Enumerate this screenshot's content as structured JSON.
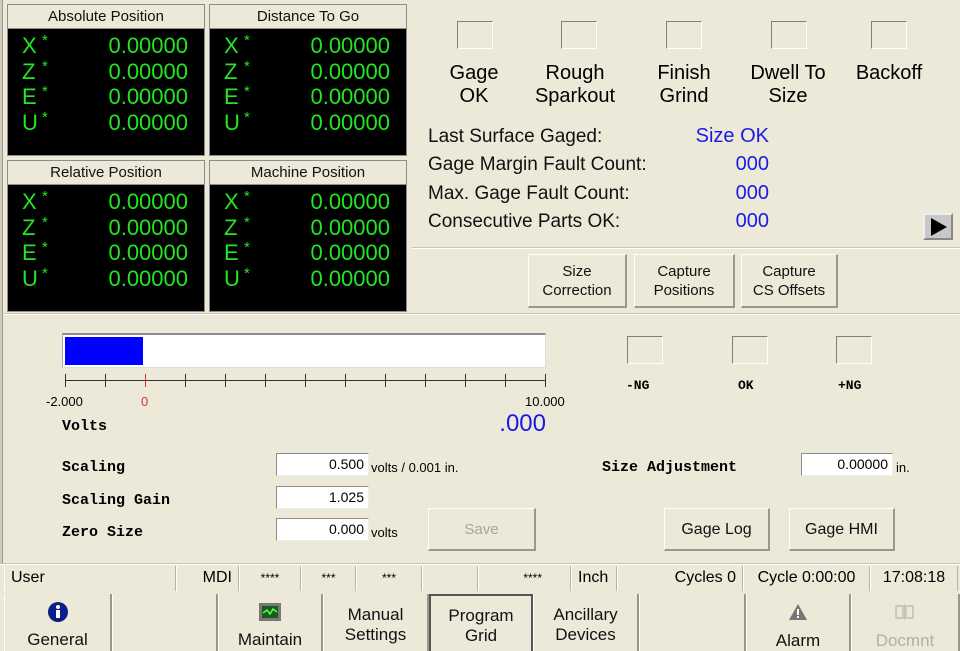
{
  "position_panels": [
    {
      "title": "Absolute Position",
      "rows": [
        {
          "axis": "X",
          "mark": "*",
          "value": "0.00000"
        },
        {
          "axis": "Z",
          "mark": "*",
          "value": "0.00000"
        },
        {
          "axis": "E",
          "mark": "*",
          "value": "0.00000"
        },
        {
          "axis": "U",
          "mark": "*",
          "value": "0.00000"
        }
      ]
    },
    {
      "title": "Distance To Go",
      "rows": [
        {
          "axis": "X",
          "mark": "*",
          "value": "0.00000"
        },
        {
          "axis": "Z",
          "mark": "*",
          "value": "0.00000"
        },
        {
          "axis": "E",
          "mark": "*",
          "value": "0.00000"
        },
        {
          "axis": "U",
          "mark": "*",
          "value": "0.00000"
        }
      ]
    },
    {
      "title": "Relative Position",
      "rows": [
        {
          "axis": "X",
          "mark": "*",
          "value": "0.00000"
        },
        {
          "axis": "Z",
          "mark": "*",
          "value": "0.00000"
        },
        {
          "axis": "E",
          "mark": "*",
          "value": "0.00000"
        },
        {
          "axis": "U",
          "mark": "*",
          "value": "0.00000"
        }
      ]
    },
    {
      "title": "Machine Position",
      "rows": [
        {
          "axis": "X",
          "mark": "*",
          "value": "0.00000"
        },
        {
          "axis": "Z",
          "mark": "*",
          "value": "0.00000"
        },
        {
          "axis": "E",
          "mark": "*",
          "value": "0.00000"
        },
        {
          "axis": "U",
          "mark": "*",
          "value": "0.00000"
        }
      ]
    }
  ],
  "gage_status": {
    "indicators": [
      {
        "line1": "Gage",
        "line2": "OK"
      },
      {
        "line1": "Rough",
        "line2": "Sparkout"
      },
      {
        "line1": "Finish",
        "line2": "Grind"
      },
      {
        "line1": "Dwell To",
        "line2": "Size"
      },
      {
        "line1": "Backoff",
        "line2": ""
      }
    ],
    "info": [
      {
        "label": "Last Surface Gaged:",
        "value": "Size OK"
      },
      {
        "label": "Gage Margin Fault Count:",
        "value": "000"
      },
      {
        "label": "Max. Gage Fault Count:",
        "value": "000"
      },
      {
        "label": "Consecutive Parts OK:",
        "value": "000"
      }
    ],
    "buttons": [
      {
        "line1": "Size",
        "line2": "Correction"
      },
      {
        "line1": "Capture",
        "line2": "Positions"
      },
      {
        "line1": "Capture",
        "line2": "CS Offsets"
      }
    ]
  },
  "gauge": {
    "min_label": "-2.000",
    "zero_label": "0",
    "max_label": "10.000",
    "min": -2.0,
    "max": 10.0,
    "bar_value": 0.0,
    "unit_label": "Volts",
    "reading": ".000",
    "colors": {
      "fill": "#0000ff",
      "zero_tick": "#e03030",
      "reading": "#1a1ae6"
    }
  },
  "tolerance_indicators": [
    {
      "label": "-NG"
    },
    {
      "label": "OK"
    },
    {
      "label": "+NG"
    }
  ],
  "settings": {
    "scaling": {
      "label": "Scaling",
      "value": "0.500",
      "unit": "volts / 0.001 in."
    },
    "scaling_gain": {
      "label": "Scaling Gain",
      "value": "1.025"
    },
    "zero_size": {
      "label": "Zero Size",
      "value": "0.000",
      "unit": "volts"
    },
    "size_adjustment": {
      "label": "Size Adjustment",
      "value": "0.00000",
      "unit": "in."
    },
    "save_label": "Save",
    "gage_log_label": "Gage Log",
    "gage_hmi_label": "Gage HMI"
  },
  "status_bar": {
    "user": "User",
    "mode": "MDI",
    "f1": "****",
    "f2": "***",
    "f3": "***",
    "f4": "",
    "f5": "****",
    "units": "Inch",
    "cycles": "Cycles 0",
    "cycle_time": "Cycle 0:00:00",
    "clock": "17:08:18"
  },
  "nav": [
    {
      "label": "General",
      "icon": "info-icon"
    },
    {
      "label": "",
      "icon": ""
    },
    {
      "label": "Maintain",
      "icon": "monitor-icon"
    },
    {
      "label": "Manual\nSettings",
      "line1": "Manual",
      "line2": "Settings"
    },
    {
      "line1": "Program",
      "line2": "Grid",
      "active": true
    },
    {
      "line1": "Ancillary",
      "line2": "Devices"
    },
    {
      "label": ""
    },
    {
      "label": "Alarm",
      "icon": "warning-icon"
    },
    {
      "label": "Docmnt",
      "icon": "document-icon",
      "disabled": true
    }
  ]
}
